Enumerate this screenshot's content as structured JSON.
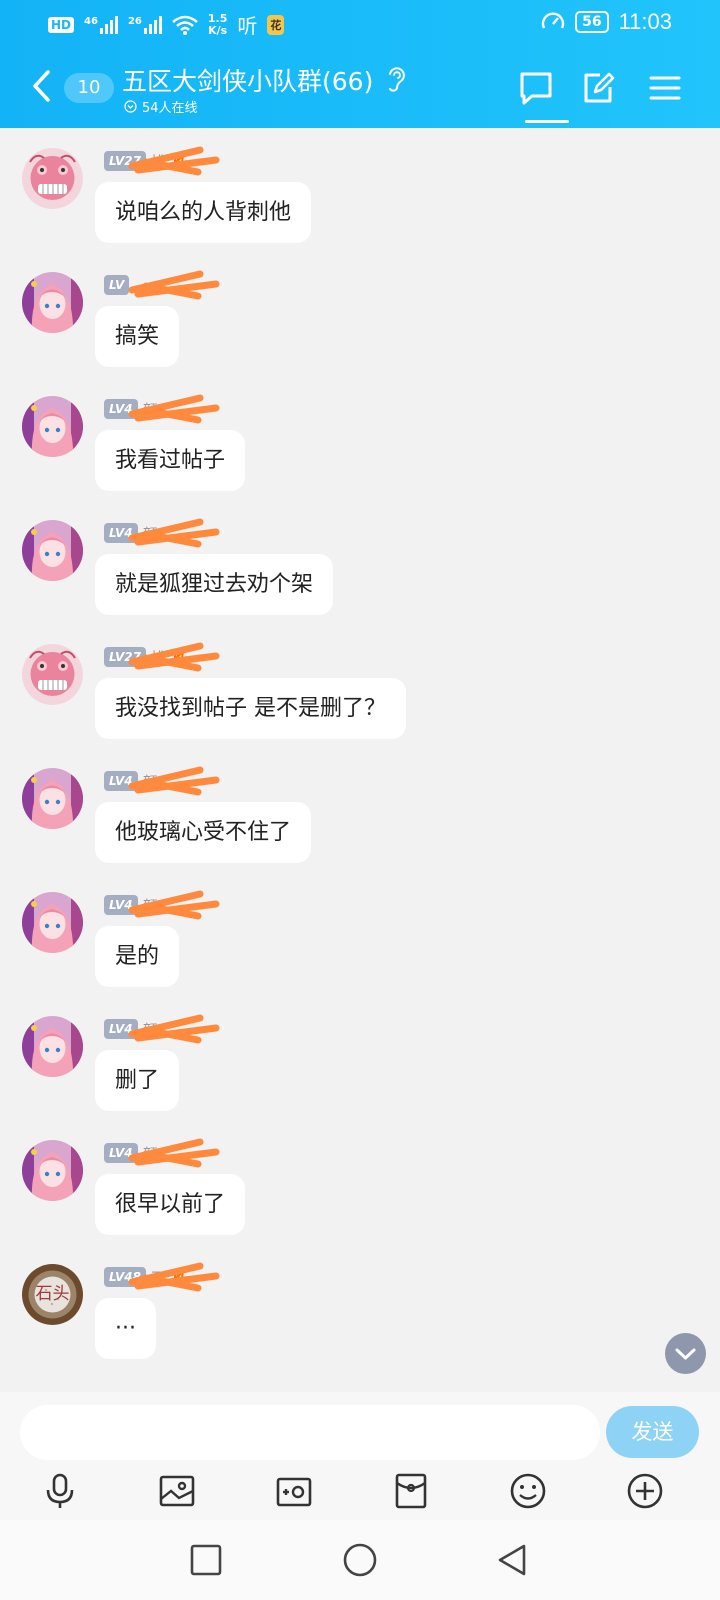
{
  "status_bar": {
    "hd_label": "HD",
    "sim1_label": "46",
    "sim2_label": "26",
    "net_speed_value": "1.5",
    "net_speed_unit": "K/s",
    "listen_label": "听",
    "app_badge": "花",
    "battery_level": "56",
    "time": "11:03"
  },
  "header": {
    "unread_count": "10",
    "group_name": "五区大剑侠小队群(66)",
    "online_text": "54人在线"
  },
  "messages": [
    {
      "level": "LV27",
      "nick": "桃",
      "has_fire": true,
      "avatar": "avatar-peach",
      "text": "说咱么的人背刺他"
    },
    {
      "level": "LV",
      "nick": "",
      "has_fire": false,
      "avatar": "avatar-pink",
      "text": "搞笑"
    },
    {
      "level": "LV4",
      "nick": "颜",
      "has_fire": false,
      "avatar": "avatar-pink",
      "text": "我看过帖子"
    },
    {
      "level": "LV4",
      "nick": "颜",
      "has_fire": false,
      "avatar": "avatar-pink",
      "text": "就是狐狸过去劝个架"
    },
    {
      "level": "LV27",
      "nick": "桃",
      "has_fire": true,
      "avatar": "avatar-peach",
      "text": "我没找到帖子 是不是删了？"
    },
    {
      "level": "LV4",
      "nick": "颜",
      "has_fire": false,
      "avatar": "avatar-pink",
      "text": "他玻璃心受不住了"
    },
    {
      "level": "LV4",
      "nick": "颜",
      "has_fire": false,
      "avatar": "avatar-pink",
      "text": "是的"
    },
    {
      "level": "LV4",
      "nick": "颜",
      "has_fire": false,
      "avatar": "avatar-pink",
      "text": "删了"
    },
    {
      "level": "LV4",
      "nick": "颜",
      "has_fire": false,
      "avatar": "avatar-pink",
      "text": "很早以前了"
    },
    {
      "level": "LV48",
      "nick": "石",
      "has_fire": true,
      "avatar": "avatar-stone",
      "avatar_text": "石头",
      "text": "···"
    }
  ],
  "input": {
    "placeholder": "",
    "send_label": "发送"
  },
  "toolbar": {
    "icons": [
      "microphone-icon",
      "image-icon",
      "camera-icon",
      "red-packet-icon",
      "emoji-icon",
      "plus-icon"
    ]
  },
  "nav": {
    "icons": [
      "recent-apps-icon",
      "home-icon",
      "back-icon"
    ]
  },
  "colors": {
    "header": "#16b8f8",
    "bubble": "#ffffff",
    "background": "#f2f2f2",
    "level_badge": "#a4adc2",
    "send_button": "#8ed2f6",
    "scribble": "#ff8a3d"
  }
}
